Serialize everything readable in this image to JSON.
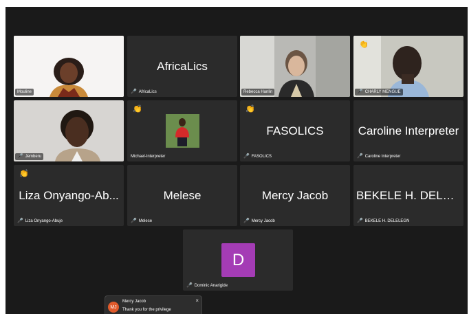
{
  "participants": {
    "mouline": {
      "name": "Mouline"
    },
    "africalics": {
      "display": "AfricaLics",
      "label": "AfricaLics"
    },
    "rebecca": {
      "name": "Rebecca Hanlin"
    },
    "charly": {
      "name": "CHARLY MENGUE"
    },
    "jemberu": {
      "name": "Jemberu"
    },
    "michael": {
      "name": "Michael-Interpreter"
    },
    "fasolics": {
      "display": "FASOLICS",
      "label": "FASOLICS"
    },
    "caroline": {
      "display": "Caroline Interpreter",
      "label": "Caroline Interpreter"
    },
    "liza": {
      "display": "Liza Onyango-Ab...",
      "label": "Liza Onyango-Abuje"
    },
    "melese": {
      "display": "Melese",
      "label": "Melese"
    },
    "mercy": {
      "display": "Mercy Jacob",
      "label": "Mercy Jacob"
    },
    "bekele": {
      "display": "BEKELE H. DELEL...",
      "label": "BEKELE H. DELELEGN"
    },
    "dominic": {
      "initial": "D",
      "label": "Dominic Anarigide",
      "color": "#a43cb5"
    }
  },
  "icons": {
    "mic_muted": "🎤",
    "raised_hand": "👏"
  },
  "active_speaker_color": "#3ddc5e",
  "chat_toast": {
    "initials": "MJ",
    "sender": "Mercy Jacob",
    "message": "Thank you for the privilege",
    "close": "×"
  }
}
